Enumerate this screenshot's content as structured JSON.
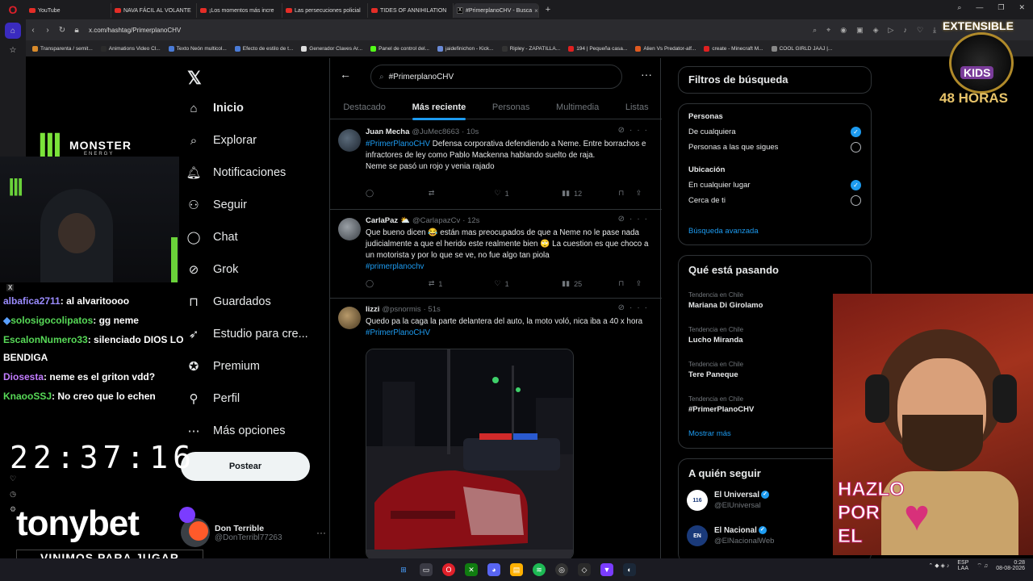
{
  "browser": {
    "tabs": [
      {
        "label": "YouTube",
        "icon": "youtube-icon"
      },
      {
        "label": "NAVA FÁCIL AL VOLANTE",
        "icon": "youtube-icon"
      },
      {
        "label": "¡Los momentos más incre",
        "icon": "youtube-icon"
      },
      {
        "label": "Las persecuciones policial",
        "icon": "youtube-icon"
      },
      {
        "label": "TIDES OF ANNIHILATION",
        "icon": "youtube-icon"
      },
      {
        "label": "#PrimerplanoCHV - Busca",
        "icon": "x-icon",
        "active": true
      }
    ],
    "url": "x.com/hashtag/PrimerplanoCHV",
    "bookmarks": [
      {
        "label": "Transparenta / semit...",
        "color": "#d98b2b"
      },
      {
        "label": "Animations Video Cl...",
        "color": "#2b2b2b"
      },
      {
        "label": "Texto Neón multicol...",
        "color": "#4a7bd6"
      },
      {
        "label": "Efecto de estilo de t...",
        "color": "#4a7bd6"
      },
      {
        "label": "Generador Claves Ar...",
        "color": "#dddddd"
      },
      {
        "label": "Panel de control del...",
        "color": "#53fc18"
      },
      {
        "label": "jaidefinichon - Kick...",
        "color": "#6a8ad6"
      },
      {
        "label": "Ripley - ZAPATILLA...",
        "color": "#333333"
      },
      {
        "label": "194 | Pequeña casa...",
        "color": "#e02020"
      },
      {
        "label": "Alien Vs Predator-alf...",
        "color": "#e05a20"
      },
      {
        "label": "create - Minecraft M...",
        "color": "#e02020"
      },
      {
        "label": "COOL GIRLD JAAJ |...",
        "color": "#888888"
      }
    ]
  },
  "nav": {
    "items": [
      {
        "label": "Inicio",
        "icon": "home-icon"
      },
      {
        "label": "Explorar",
        "icon": "search-icon"
      },
      {
        "label": "Notificaciones",
        "icon": "bell-icon"
      },
      {
        "label": "Seguir",
        "icon": "follow-icon"
      },
      {
        "label": "Chat",
        "icon": "chat-icon"
      },
      {
        "label": "Grok",
        "icon": "grok-icon"
      },
      {
        "label": "Guardados",
        "icon": "bookmark-icon"
      },
      {
        "label": "Estudio para cre...",
        "icon": "studio-icon"
      },
      {
        "label": "Premium",
        "icon": "premium-icon"
      },
      {
        "label": "Perfil",
        "icon": "profile-icon"
      },
      {
        "label": "Más opciones",
        "icon": "more-icon"
      }
    ],
    "post_label": "Postear",
    "profile_name": "Don Terrible",
    "profile_handle": "@DonTerribl77263"
  },
  "feed": {
    "search_value": "#PrimerplanoCHV",
    "tabs": [
      "Destacado",
      "Más reciente",
      "Personas",
      "Multimedia",
      "Listas"
    ],
    "active_tab": 1,
    "tweets": [
      {
        "name": "Juan Mecha",
        "handle": "@JuMec8663",
        "time": "· 10s",
        "hashtag": "#PrimerPlanoCHV",
        "text": " Defensa corporativa defendiendo a Neme. Entre borrachos e infractores de ley como Pablo Mackenna hablando suelto de raja.",
        "text2": "Neme se pasó un rojo y venia rajado",
        "replies": "",
        "reposts": "",
        "likes": "1",
        "views": "12"
      },
      {
        "name": "CarlaPaz",
        "emoji": "⛅",
        "handle": "@CarlapazCv",
        "time": "· 12s",
        "text": "Que bueno dicen 😂 están mas preocupados de que a Neme no le pase nada judicialmente a que el herido este realmente bien 🙄 La cuestion es que choco a un motorista y por lo que se ve, no fue algo tan piola",
        "hashtag": "#primerplanochv",
        "replies": "",
        "reposts": "1",
        "likes": "1",
        "views": "25"
      },
      {
        "name": "lizzi",
        "handle": "@psnormis",
        "time": "· 51s",
        "text": "Quedo pa la caga la parte delantera del auto, la moto voló, nica iba a 40 x hora ",
        "hashtag": "#PrimerPlanoCHV"
      }
    ]
  },
  "right": {
    "filters_title": "Filtros de búsqueda",
    "people_label": "Personas",
    "people_opt1": "De cualquiera",
    "people_opt2": "Personas a las que sigues",
    "location_label": "Ubicación",
    "loc_opt1": "En cualquier lugar",
    "loc_opt2": "Cerca de ti",
    "advanced": "Búsqueda avanzada",
    "trends_title": "Qué está pasando",
    "trends": [
      {
        "label": "Tendencia en Chile",
        "name": "Mariana Di Girolamo"
      },
      {
        "label": "Tendencia en Chile",
        "name": "Lucho Miranda"
      },
      {
        "label": "Tendencia en Chile",
        "name": "Tere Paneque"
      },
      {
        "label": "Tendencia en Chile",
        "name": "#PrimerPlanoCHV"
      }
    ],
    "show_more": "Mostrar más",
    "follow_title": "A quién seguir",
    "follow": [
      {
        "name": "El Universal",
        "handle": "@ElUniversal",
        "badge": "116"
      },
      {
        "name": "El Nacional",
        "handle": "@ElNacionalWeb",
        "badge": "EN"
      }
    ]
  },
  "overlay": {
    "chat": [
      {
        "user": "albafica2711",
        "msg": ": al alvaritoooo",
        "color": "#9b8cff"
      },
      {
        "user": "solosigocolipatos",
        "msg": ": gg neme",
        "color": "#57d957"
      },
      {
        "user": "EscalonNumero33",
        "msg": ": silenciado DIOS LO",
        "msg2": "BENDIGA",
        "color": "#57d957"
      },
      {
        "user": "Diosesta",
        "msg": ": neme es el griton vdd?",
        "color": "#c27cff"
      },
      {
        "user": "KnaooSSJ",
        "msg": ": No creo que lo echen",
        "color": "#57d957"
      }
    ],
    "clock": "22:37:16",
    "sponsor": "tonybet",
    "sponsor_tagline": "VINIMOS PARA JUGAR",
    "monster": "MONSTER",
    "monster_sub": "ENERGY",
    "extensible": "EXTENSIBLE",
    "kids": "KIDS",
    "hours": "48 HORAS",
    "hazlo": "HAZLO",
    "por": "POR",
    "el": "EL"
  },
  "taskbar": {
    "lang": "ESP",
    "lang2": "LAA",
    "time": "0:28",
    "date": "08-08-2026"
  }
}
